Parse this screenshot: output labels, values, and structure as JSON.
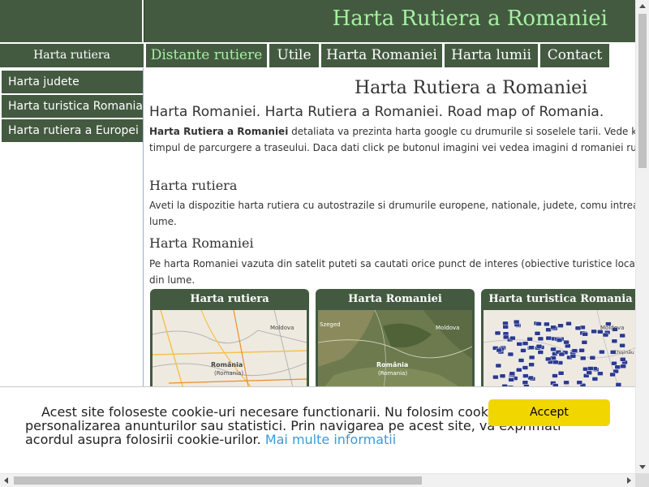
{
  "header": {
    "site_title": "Harta Rutiera a Romaniei"
  },
  "nav": {
    "side_label": "Harta rutiera",
    "tabs": [
      {
        "label": "Distante rutiere",
        "active": true
      },
      {
        "label": "Utile",
        "active": false
      },
      {
        "label": "Harta Romaniei",
        "active": false
      },
      {
        "label": "Harta lumii",
        "active": false
      },
      {
        "label": "Contact",
        "active": false
      }
    ]
  },
  "sidebar": {
    "items": [
      {
        "label": "Harta judete"
      },
      {
        "label": "Harta turistica Romania"
      },
      {
        "label": "Harta rutiera a Europei"
      }
    ]
  },
  "main": {
    "heading": "Harta Rutiera a Romaniei",
    "subheading": "Harta Romaniei. Harta Rutiera a Romaniei. Road map of Romania.",
    "intro_bold": "Harta Rutiera a Romaniei",
    "intro_rest": " detaliata va prezinta harta google cu drumurile si soselele tarii. Vede km si timpul de parcurgere a traseului. Daca dati click pe butonul imagini vei vedea imagini d romaniei rutiera.",
    "sections": [
      {
        "title": "Harta rutiera",
        "text": "Aveti la dispozitie harta rutiera cu autostrazile si drumurile europene, nationale, judete, comu intreaga lume."
      },
      {
        "title": "Harta Romaniei",
        "text": "Pe harta Romaniei vazuta din satelit puteti sa cautati orice punct de interes (obiective turistice localitate din lume."
      }
    ],
    "thumbnails": [
      {
        "title": "Harta rutiera",
        "map_labels": [
          "Moldova",
          "România",
          "(Romania)"
        ]
      },
      {
        "title": "Harta Romaniei",
        "map_labels": [
          "Moldova",
          "România",
          "(Romania)",
          "Szeged"
        ]
      },
      {
        "title": "Harta turistica Romania",
        "map_labels": [
          "Moldova",
          "Chișinău"
        ]
      }
    ]
  },
  "cookie": {
    "text": "Acest site foloseste cookie-uri necesare functionarii. Nu folosim cookie-uri pentru personalizarea anunturilor sau statistici. Prin navigarea pe acest site, va exprimati acordul asupra folosirii cookie-urilor.",
    "link_label": "Mai multe informatii",
    "accept_label": "Accept",
    "accept_color": "#f1d600",
    "link_color": "#3c9ad6"
  },
  "colors": {
    "primary_green": "#435a40",
    "highlight_green": "#a6f0a2"
  }
}
